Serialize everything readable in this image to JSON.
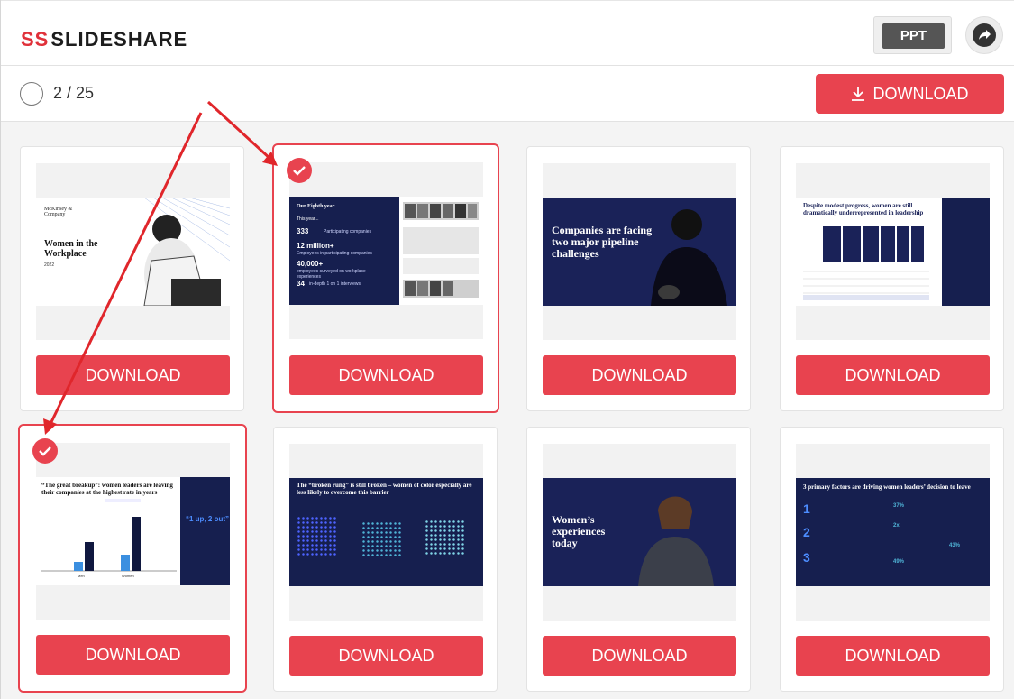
{
  "header": {
    "logo_mark": "SS",
    "logo_text": "SLIDESHARE",
    "ppt_label": "PPT"
  },
  "toolbar": {
    "counter": "2 / 25",
    "download_label": "DOWNLOAD"
  },
  "colors": {
    "accent": "#e8434f",
    "navy": "#161f4f"
  },
  "cards": [
    {
      "download_label": "DOWNLOAD",
      "selected": false,
      "slide": {
        "title": "Women in the Workplace",
        "year": "2022",
        "brand": "McKinsey & Company"
      }
    },
    {
      "download_label": "DOWNLOAD",
      "selected": true,
      "slide": {
        "heading": "Our Eighth year",
        "sub": "This year...",
        "stats": [
          {
            "value": "333",
            "text": "Participating companies"
          },
          {
            "value": "12 million+",
            "text": "Employees in participating companies"
          },
          {
            "value": "40,000+",
            "text": "employees surveyed on workplace experiences"
          },
          {
            "value": "34",
            "text": "in-depth 1 on 1 interviews"
          }
        ]
      }
    },
    {
      "download_label": "DOWNLOAD",
      "selected": false,
      "slide": {
        "title": "Companies are facing two major pipeline challenges"
      }
    },
    {
      "download_label": "DOWNLOAD",
      "selected": false,
      "slide": {
        "title": "Despite modest progress, women are still dramatically underrepresented in leadership"
      }
    },
    {
      "download_label": "DOWNLOAD",
      "selected": true,
      "slide": {
        "title": "“The great breakup”: women leaders are leaving their companies at the highest rate in years",
        "callout": "“1 up, 2 out”",
        "categories": [
          "Men",
          "Women"
        ]
      }
    },
    {
      "download_label": "DOWNLOAD",
      "selected": false,
      "slide": {
        "title": "The “broken rung” is still broken – women of color especially are less likely to overcome this barrier"
      }
    },
    {
      "download_label": "DOWNLOAD",
      "selected": false,
      "slide": {
        "title": "Women’s experiences today"
      }
    },
    {
      "download_label": "DOWNLOAD",
      "selected": false,
      "slide": {
        "title": "3 primary factors are driving women leaders’ decision to leave",
        "numbers": [
          "1",
          "2",
          "3"
        ],
        "percents": [
          "37%",
          "2x",
          "43%",
          "49%"
        ]
      }
    }
  ]
}
